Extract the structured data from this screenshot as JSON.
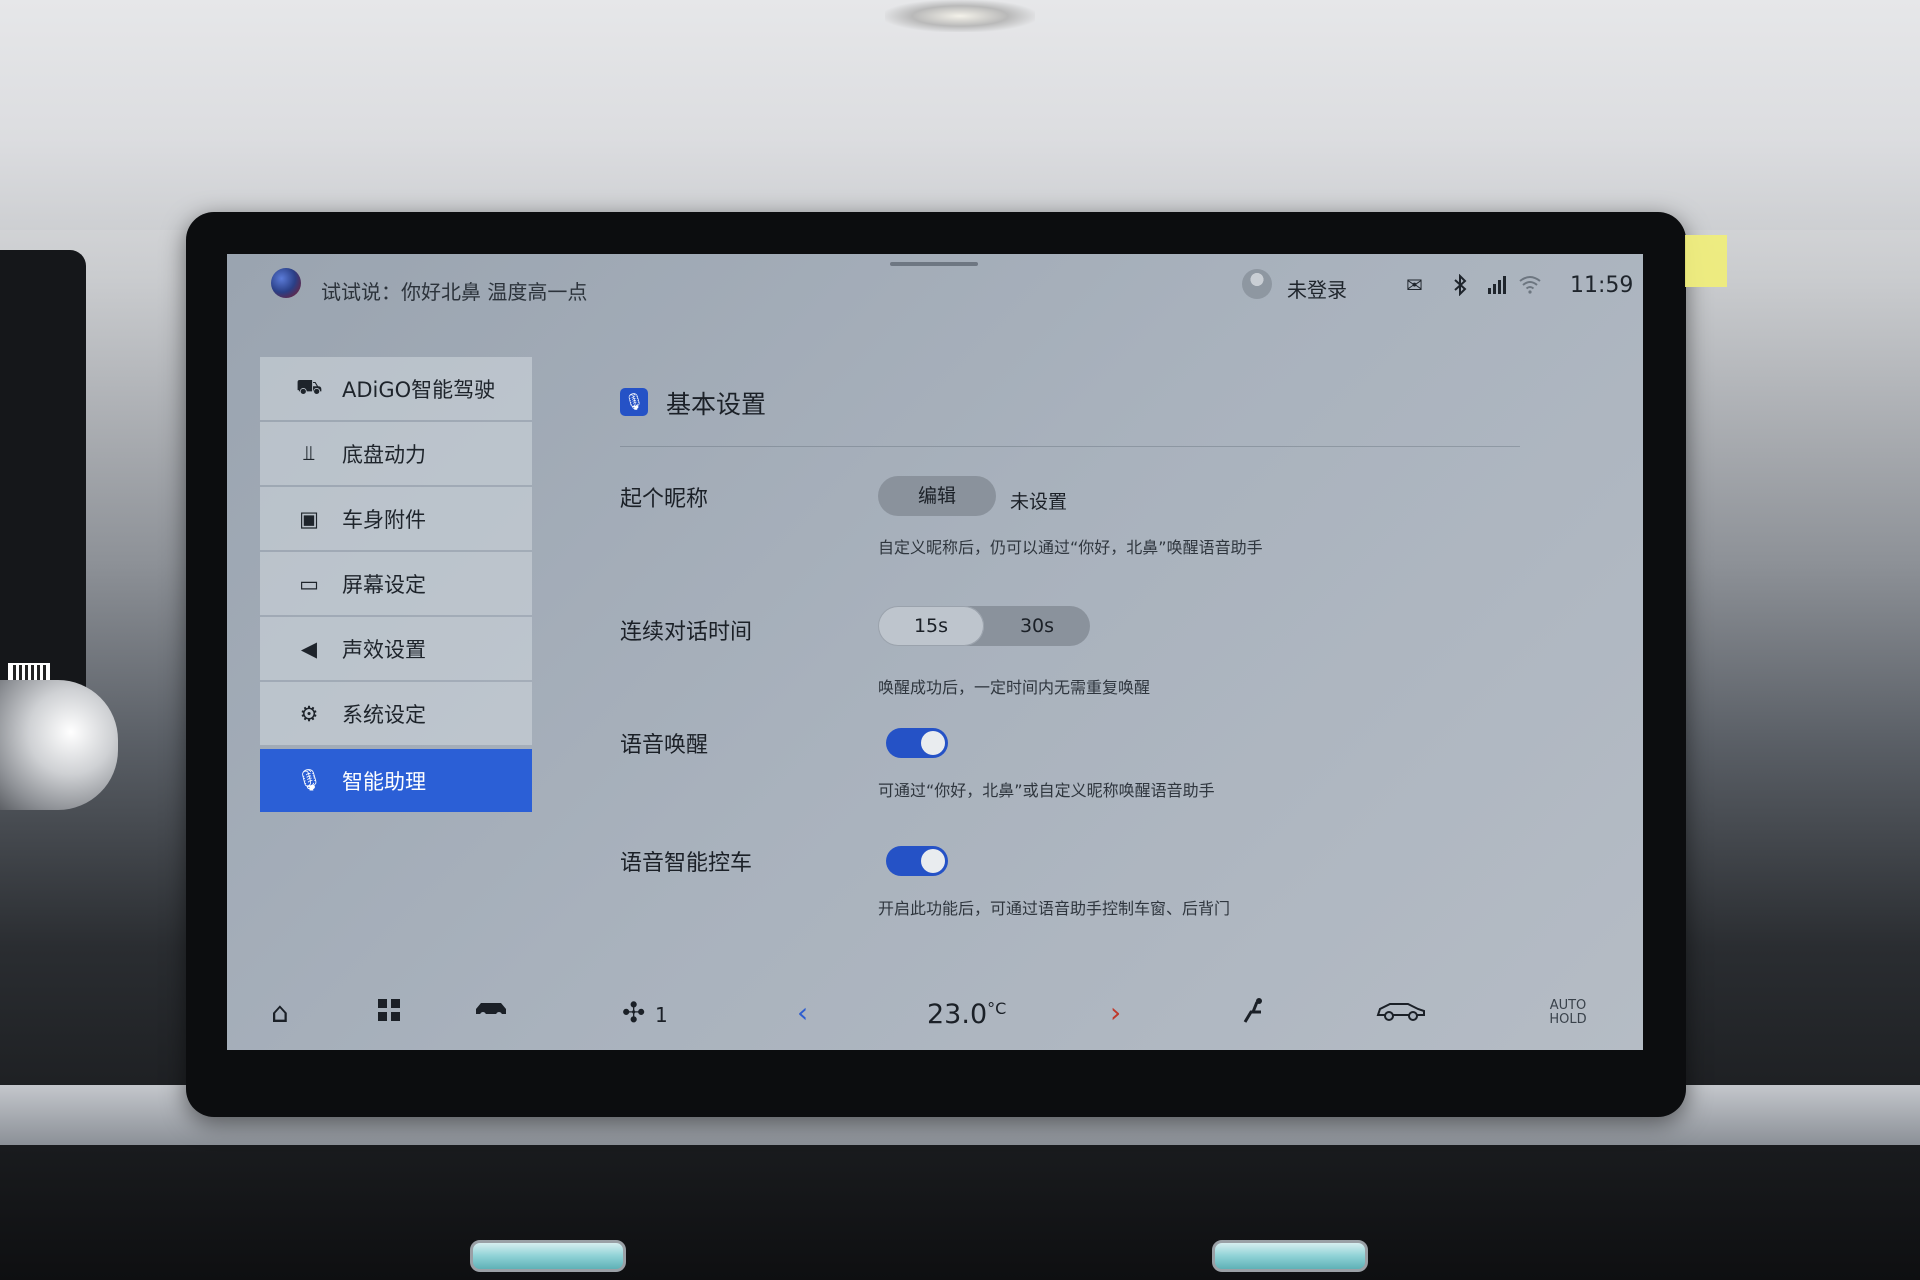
{
  "status_bar": {
    "hint": "试试说：你好北鼻 温度高一点",
    "user_status": "未登录",
    "mail_icon": "envelope-icon",
    "bluetooth_icon": "bluetooth-icon",
    "signal_icon": "signal-4g-icon",
    "wifi_icon": "wifi-icon",
    "time": "11:59"
  },
  "sidebar": {
    "items": [
      {
        "label": "ADiGO智能驾驶",
        "icon": "steering-assist-icon"
      },
      {
        "label": "底盘动力",
        "icon": "chassis-icon"
      },
      {
        "label": "车身附件",
        "icon": "car-body-icon"
      },
      {
        "label": "屏幕设定",
        "icon": "monitor-icon"
      },
      {
        "label": "声效设置",
        "icon": "speaker-icon"
      },
      {
        "label": "系统设定",
        "icon": "gear-icon"
      },
      {
        "label": "智能助理",
        "icon": "microphone-icon",
        "active": true
      }
    ]
  },
  "main": {
    "section_title": "基本设置",
    "section_icon": "microphone-icon",
    "nickname": {
      "label": "起个昵称",
      "button": "编辑",
      "value": "未设置",
      "desc": "自定义昵称后，仍可以通过“你好，北鼻”唤醒语音助手"
    },
    "continuous": {
      "label": "连续对话时间",
      "options": [
        "15s",
        "30s"
      ],
      "selected": "15s",
      "desc": "唤醒成功后，一定时间内无需重复唤醒"
    },
    "voice_wake": {
      "label": "语音唤醒",
      "enabled": true,
      "desc": "可通过“你好，北鼻”或自定义昵称唤醒语音助手"
    },
    "voice_control": {
      "label": "语音智能控车",
      "enabled": true,
      "desc": "开启此功能后，可通过语音助手控制车窗、后背门"
    }
  },
  "dock": {
    "fan_level": "1",
    "temperature": "23.0",
    "temperature_unit": "°C",
    "auto_hold_line1": "AUTO",
    "auto_hold_line2": "HOLD"
  },
  "colors": {
    "accent": "#2b5fd6",
    "toggle_on": "#2552c6",
    "screen_bg": "#a9b2bd"
  }
}
